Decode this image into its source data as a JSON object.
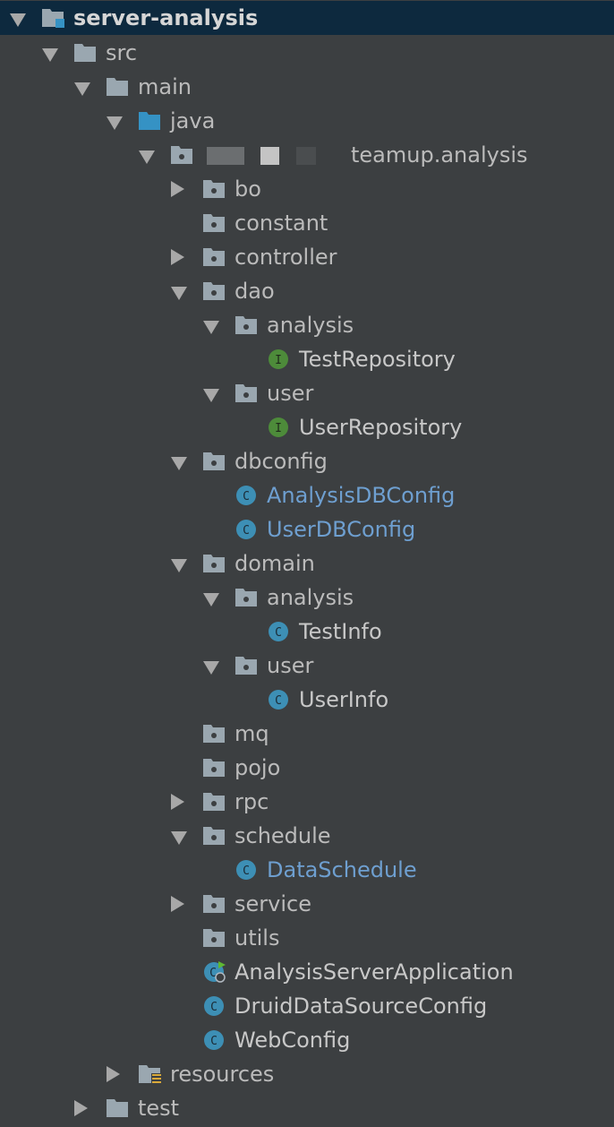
{
  "project_tree": {
    "root": "server-analysis",
    "src": "src",
    "main": "main",
    "java": "java",
    "package": "teamup.analysis",
    "items": {
      "bo": "bo",
      "constant": "constant",
      "controller": "controller",
      "dao": "dao",
      "dao_analysis": "analysis",
      "test_repository": "TestRepository",
      "dao_user": "user",
      "user_repository": "UserRepository",
      "dbconfig": "dbconfig",
      "analysis_db_config": "AnalysisDBConfig",
      "user_db_config": "UserDBConfig",
      "domain": "domain",
      "domain_analysis": "analysis",
      "test_info": "TestInfo",
      "domain_user": "user",
      "user_info": "UserInfo",
      "mq": "mq",
      "pojo": "pojo",
      "rpc": "rpc",
      "schedule": "schedule",
      "data_schedule": "DataSchedule",
      "service": "service",
      "utils": "utils",
      "app": "AnalysisServerApplication",
      "druid": "DruidDataSourceConfig",
      "web_config": "WebConfig"
    },
    "resources": "resources",
    "test": "test"
  },
  "icon_letters": {
    "interface": "I",
    "class": "C"
  },
  "colors": {
    "background": "#3c3f41",
    "selected_row": "#0d293e",
    "text": "#bbbbbb",
    "modified_text": "#6e9fd0",
    "folder": "#9aa7b0",
    "source_folder": "#3592c4",
    "class_icon": "#3d8fb5",
    "interface_icon": "#4d8b3a"
  }
}
